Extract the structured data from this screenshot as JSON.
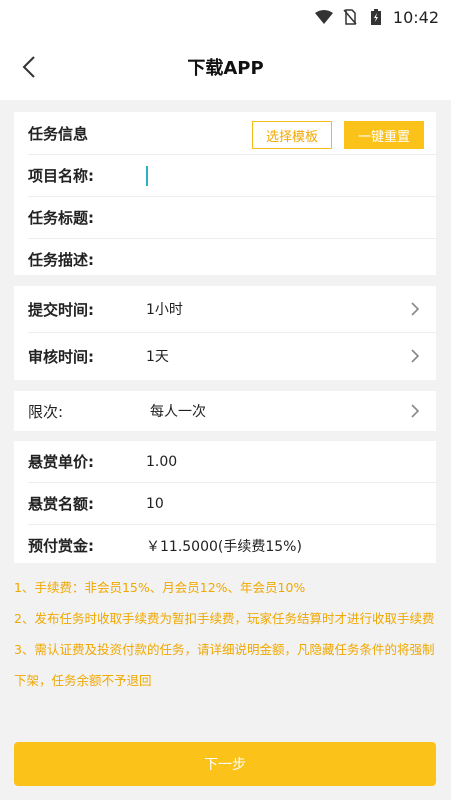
{
  "status_bar": {
    "time": "10:42"
  },
  "header": {
    "title": "下载APP"
  },
  "task_info": {
    "section_title": "任务信息",
    "template_button": "选择模板",
    "reset_button": "一键重置",
    "project_name_label": "项目名称:",
    "project_name_value": "",
    "task_title_label": "任务标题:",
    "task_title_value": "",
    "task_desc_label": "任务描述:",
    "task_desc_value": ""
  },
  "timing": {
    "submit_label": "提交时间:",
    "submit_value": "1小时",
    "review_label": "审核时间:",
    "review_value": "1天"
  },
  "limit": {
    "label": "限次:",
    "value": "每人一次"
  },
  "reward": {
    "unit_price_label": "悬赏单价:",
    "unit_price_value": "1.00",
    "quota_label": "悬赏名额:",
    "quota_value": "10",
    "prepaid_label": "预付赏金:",
    "prepaid_value": "￥11.5000(手续费15%)"
  },
  "notes": {
    "line1": "1、手续费：非会员15%、月会员12%、年会员10%",
    "line2": "2、发布任务时收取手续费为暂扣手续费，玩家任务结算时才进行收取手续费",
    "line3": " 3、需认证费及投资付款的任务，请详细说明金额，凡隐藏任务条件的将强制下架，任务余额不予退回"
  },
  "footer": {
    "next_button": "下一步"
  },
  "colors": {
    "accent": "#fbc21a",
    "accent_text": "#f0a800",
    "cursor": "#2bb3c0"
  }
}
